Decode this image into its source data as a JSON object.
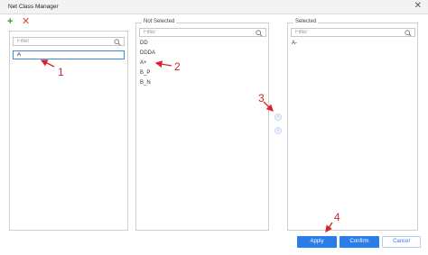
{
  "window": {
    "title": "Net Class Manager",
    "close_glyph": "✕"
  },
  "toolbar": {
    "add_glyph": "+",
    "delete_glyph": "✕"
  },
  "left_panel": {
    "filter_placeholder": "Filter",
    "edit_value": "A"
  },
  "not_selected": {
    "header": "Not Selected",
    "filter_placeholder": "Filter",
    "items": [
      "DD",
      "DDDA",
      "A+",
      "B_P",
      "B_N"
    ]
  },
  "selected": {
    "header": "Selected",
    "filter_placeholder": "Filter",
    "items": [
      "A-"
    ]
  },
  "transfer": {
    "move_right_glyph": "›",
    "move_left_glyph": "‹"
  },
  "buttons": {
    "apply": "Apply",
    "confirm": "Confirm",
    "cancel": "Cancel"
  },
  "annotations": {
    "n1": "1",
    "n2": "2",
    "n3": "3",
    "n4": "4",
    "color": "#d8232a"
  },
  "icons": {
    "search": "search-icon",
    "add": "plus-icon",
    "delete": "close-icon"
  }
}
